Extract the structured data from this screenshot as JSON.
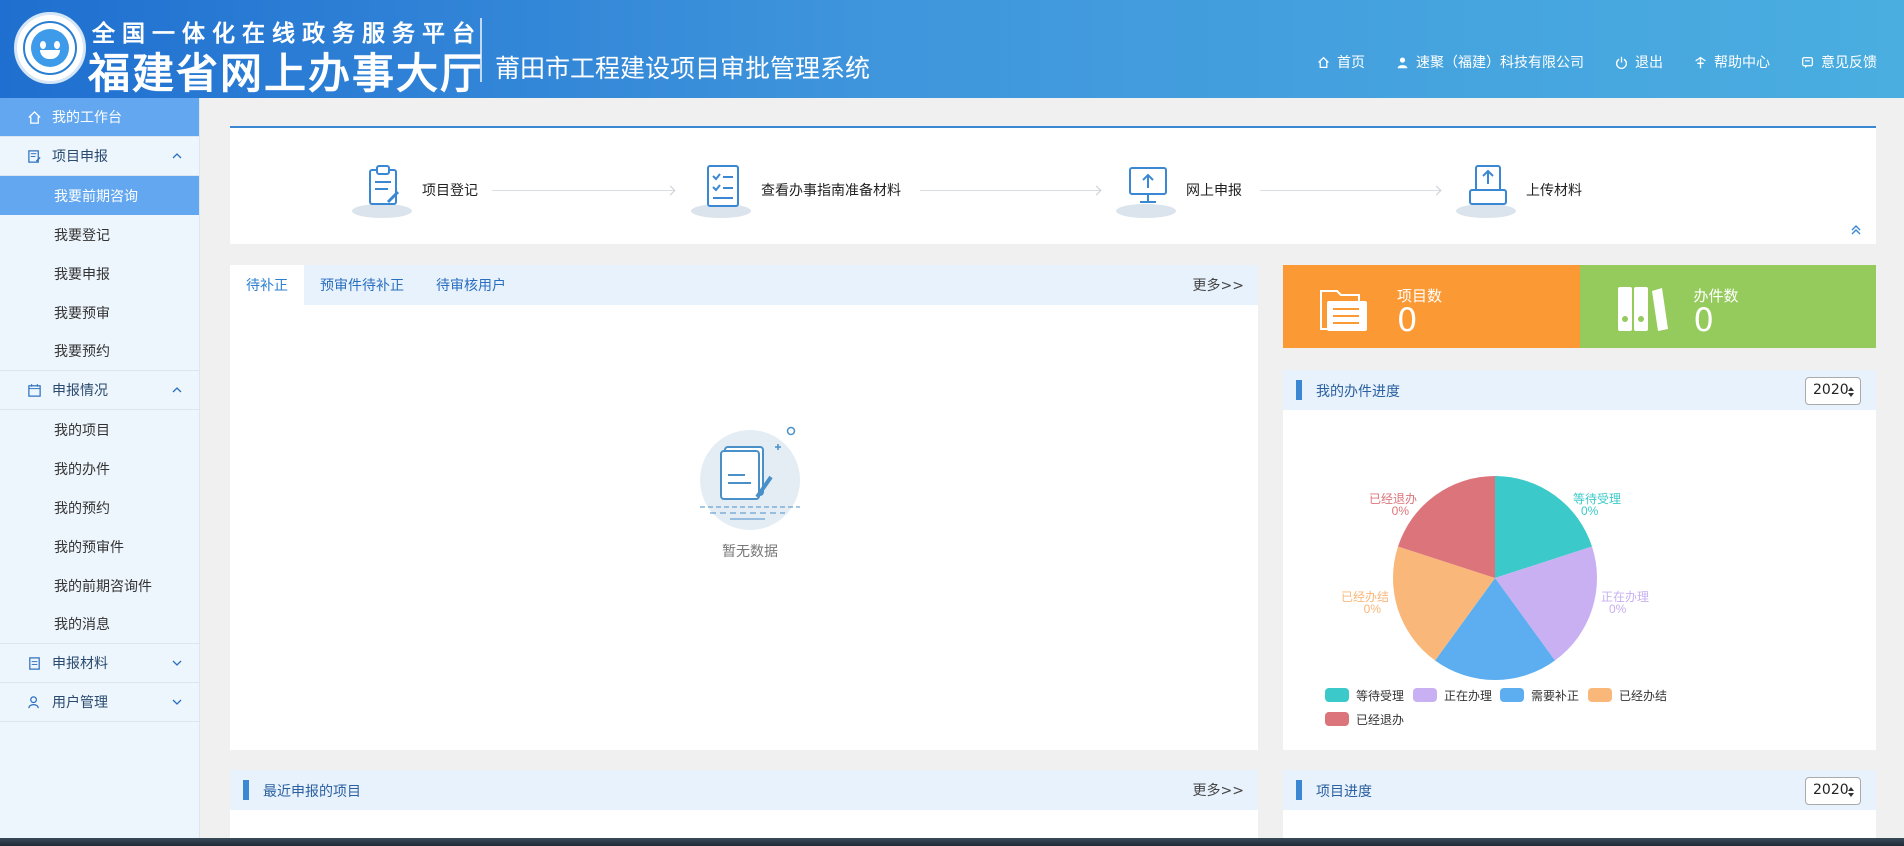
{
  "header": {
    "brand_line1": "全国一体化在线政务服务平台",
    "brand_line2": "福建省网上办事大厅",
    "system_name": "莆田市工程建设项目审批管理系统",
    "nav": [
      {
        "label": "首页",
        "icon": "home-icon"
      },
      {
        "label": "速聚（福建）科技有限公司",
        "icon": "user-icon"
      },
      {
        "label": "退出",
        "icon": "power-icon"
      },
      {
        "label": "帮助中心",
        "icon": "help-icon"
      },
      {
        "label": "意见反馈",
        "icon": "feedback-icon"
      }
    ]
  },
  "sidebar": {
    "workbench": "我的工作台",
    "groups": [
      {
        "label": "项目申报",
        "expanded": true,
        "items": [
          "我要前期咨询",
          "我要登记",
          "我要申报",
          "我要预审",
          "我要预约"
        ]
      },
      {
        "label": "申报情况",
        "expanded": true,
        "items": [
          "我的项目",
          "我的办件",
          "我的预约",
          "我的预审件",
          "我的前期咨询件",
          "我的消息"
        ]
      },
      {
        "label": "申报材料",
        "expanded": false,
        "items": []
      },
      {
        "label": "用户管理",
        "expanded": false,
        "items": []
      }
    ],
    "active_item": "我要前期咨询"
  },
  "steps": [
    "项目登记",
    "查看办事指南准备材料",
    "网上申报",
    "上传材料"
  ],
  "tabs": {
    "items": [
      "待补正",
      "预审件待补正",
      "待审核用户"
    ],
    "active": "待补正",
    "more": "更多>>",
    "empty_text": "暂无数据"
  },
  "stats": [
    {
      "label": "项目数",
      "value": "0",
      "color": "#fb9a34"
    },
    {
      "label": "办件数",
      "value": "0",
      "color": "#95cb5c"
    }
  ],
  "progress": {
    "title": "我的办件进度",
    "year": "2020"
  },
  "chart_data": {
    "type": "pie",
    "slices": [
      {
        "name": "等待受理",
        "value": 0,
        "percent": "0%",
        "color": "#3cc9c9"
      },
      {
        "name": "正在办理",
        "value": 0,
        "percent": "0%",
        "color": "#c8b0f2"
      },
      {
        "name": "需要补正",
        "value": 0,
        "percent": "0%",
        "color": "#5caef0"
      },
      {
        "name": "已经办结",
        "value": 0,
        "percent": "0%",
        "color": "#f9b77a"
      },
      {
        "name": "已经退办",
        "value": 0,
        "percent": "0%",
        "color": "#dc747b"
      }
    ],
    "legend_position": "bottom-left"
  },
  "recent": {
    "title": "最近申报的项目",
    "more": "更多>>"
  },
  "project_progress": {
    "title": "项目进度",
    "year": "2020"
  }
}
